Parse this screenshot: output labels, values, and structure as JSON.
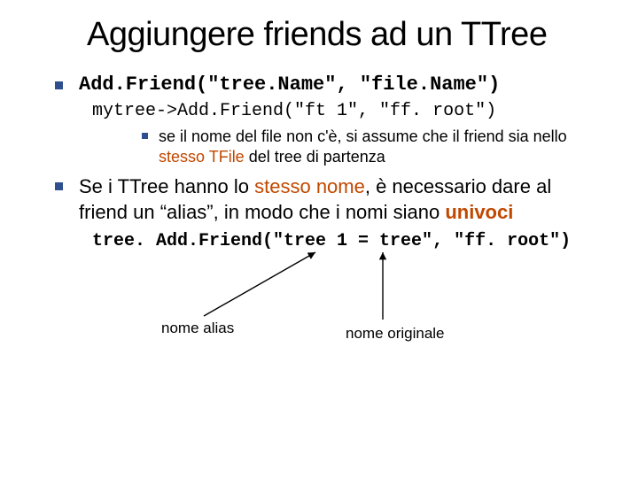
{
  "title": "Aggiungere friends ad un TTree",
  "bullet1": {
    "code": "Add.Friend(\"tree.Name\", \"file.Name\")"
  },
  "bullet2": {
    "code": "mytree->Add.Friend(\"ft 1\", \"ff. root\")"
  },
  "bullet3": {
    "pre": "se il nome del file non c'è, si assume che il friend sia nello ",
    "accent": "stesso TFile",
    "post": " del tree di partenza"
  },
  "bullet4": {
    "pre": "Se i TTree hanno lo ",
    "accent1": "stesso nome",
    "mid": ", è necessario dare al friend un “alias”, in modo che i nomi siano ",
    "accent2": "univoci"
  },
  "bullet5": {
    "code": "tree. Add.Friend(\"tree 1 = tree\", \"ff. root\")"
  },
  "labels": {
    "alias": "nome alias",
    "orig": "nome originale"
  }
}
